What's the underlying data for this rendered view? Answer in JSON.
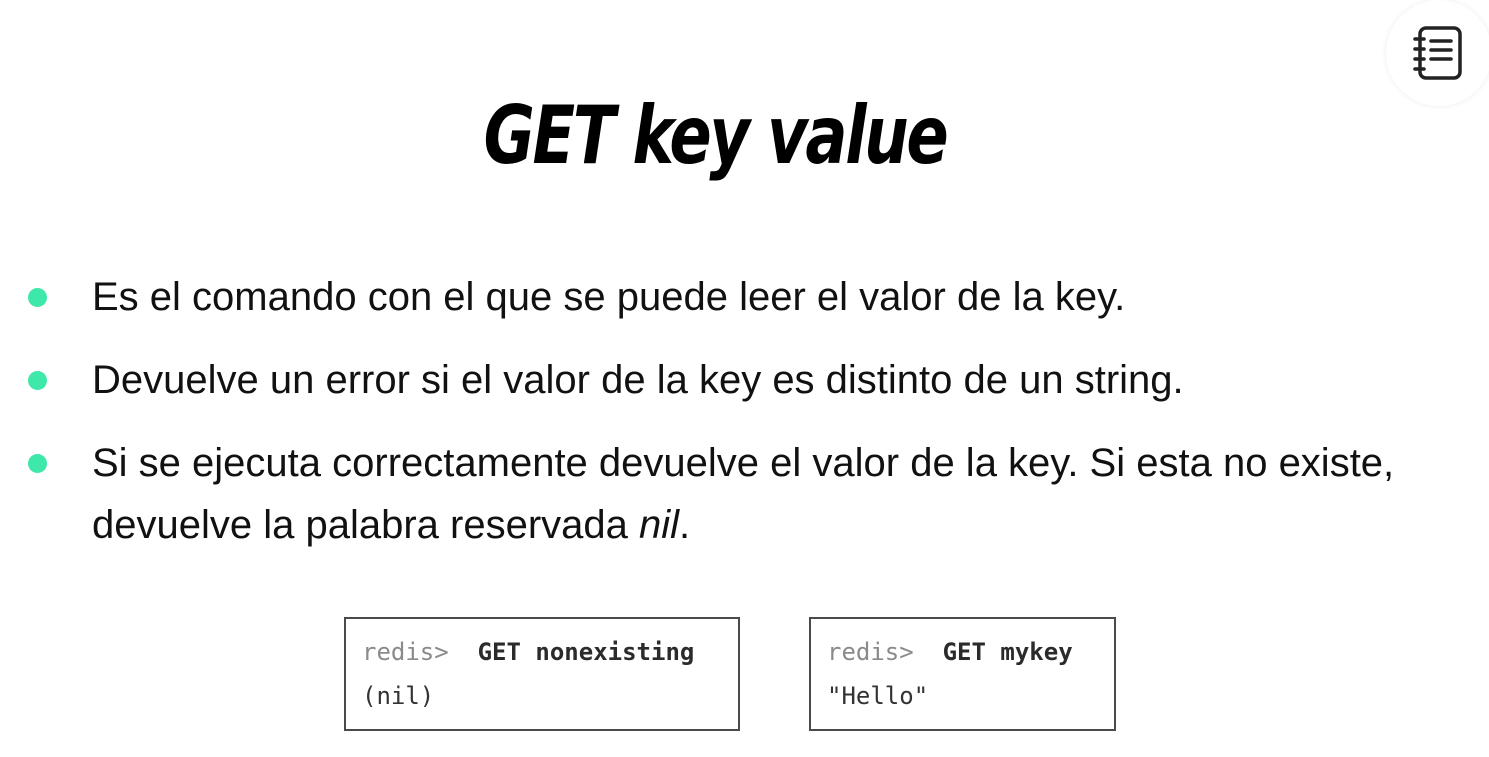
{
  "slide": {
    "title": "GET key value"
  },
  "notes_button": {
    "icon": "notebook-icon"
  },
  "bullets": [
    {
      "text": "Es el comando con el que se puede leer el valor de la key."
    },
    {
      "text": "Devuelve un error si el valor de la key es distinto de un string."
    },
    {
      "text_before": "Si se ejecuta correctamente devuelve el valor de la key. Si esta no existe, devuelve la palabra reservada ",
      "emphasis": "nil",
      "text_after": "."
    }
  ],
  "bullet_color": "#3ee8a9",
  "code_examples": [
    {
      "prompt": "redis>",
      "command": "GET nonexisting",
      "output": "(nil)"
    },
    {
      "prompt": "redis>",
      "command": "GET mykey",
      "output": "\"Hello\""
    }
  ]
}
